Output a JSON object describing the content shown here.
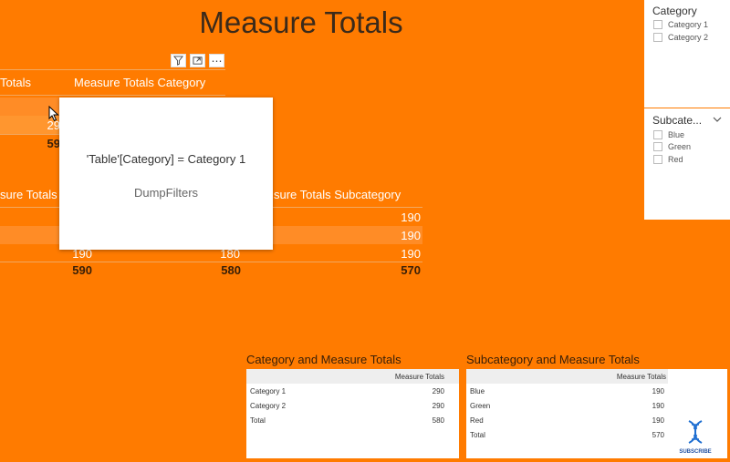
{
  "page_title": "Measure Totals",
  "colors": {
    "background": "#FF7B00",
    "title": "#3b2a1a",
    "panel": "#FFFFFF"
  },
  "toolbar": {
    "icons": [
      "filter-icon",
      "focus-mode-icon",
      "more-options-icon"
    ],
    "more": "⋯"
  },
  "matrix1": {
    "col1_header": "Totals",
    "col2_header": "Measure Totals Category",
    "rows": [
      "",
      "29"
    ],
    "total": "59"
  },
  "matrix2": {
    "col1_header": "sure Totals",
    "col3_header": "sure Totals Subcategory",
    "rows": [
      {
        "c1": "",
        "c2": "",
        "c3": "190"
      },
      {
        "c1": "",
        "c2": "",
        "c3": "190"
      },
      {
        "c1": "190",
        "c2": "180",
        "c3": "190"
      }
    ],
    "totals": {
      "c1": "590",
      "c2": "580",
      "c3": "570"
    }
  },
  "tooltip": {
    "line1": "'Table'[Category] = Category 1",
    "line2": "DumpFilters"
  },
  "slicer_category": {
    "title": "Category",
    "items": [
      "Category 1",
      "Category 2"
    ]
  },
  "slicer_subcategory": {
    "title": "Subcate...",
    "items": [
      "Blue",
      "Green",
      "Red"
    ]
  },
  "table_category": {
    "title": "Category and Measure Totals",
    "header": "Measure Totals",
    "rows": [
      {
        "label": "Category 1",
        "value": "290"
      },
      {
        "label": "Category 2",
        "value": "290"
      },
      {
        "label": "Total",
        "value": "580"
      }
    ]
  },
  "table_subcategory": {
    "title": "Subcategory and Measure Totals",
    "header": "Measure Totals",
    "rows": [
      {
        "label": "Blue",
        "value": "190"
      },
      {
        "label": "Green",
        "value": "190"
      },
      {
        "label": "Red",
        "value": "190"
      },
      {
        "label": "Total",
        "value": "570"
      }
    ]
  },
  "subscribe": {
    "label": "SUBSCRIBE",
    "icon": "dna-icon"
  }
}
